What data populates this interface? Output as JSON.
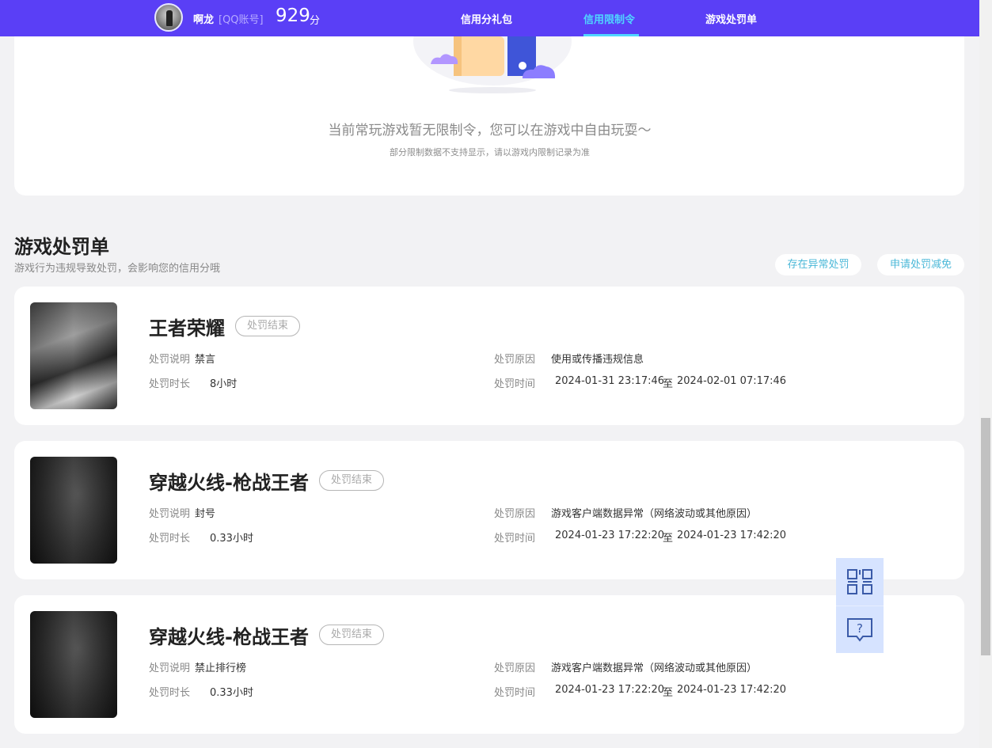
{
  "header": {
    "username": "啊龙",
    "account_type": "[QQ账号]",
    "score": "929",
    "score_unit": "分",
    "nav": [
      {
        "label": "信用分礼包",
        "active": false
      },
      {
        "label": "信用限制令",
        "active": true
      },
      {
        "label": "游戏处罚单",
        "active": false
      }
    ],
    "accent_color": "#5a3ff6",
    "active_color": "#4fd6ff"
  },
  "restriction": {
    "empty_title": "当前常玩游戏暂无限制令，您可以在游戏中自由玩耍～",
    "empty_note": "部分限制数据不支持显示，请以游戏内限制记录为准"
  },
  "penalties": {
    "title": "游戏处罚单",
    "subtitle": "游戏行为违规导致处罚，会影响您的信用分哦",
    "actions": {
      "report_abnormal": "存在异常处罚",
      "apply_reduction": "申请处罚减免"
    },
    "labels": {
      "description": "处罚说明",
      "duration": "处罚时长",
      "reason": "处罚原因",
      "time": "处罚时间",
      "to": "至"
    },
    "items": [
      {
        "game": "王者荣耀",
        "status": "处罚结束",
        "description": "禁言",
        "duration": "8小时",
        "reason": "使用或传播违规信息",
        "start": "2024-01-31 23:17:46",
        "end": "2024-02-01 07:17:46"
      },
      {
        "game": "穿越火线-枪战王者",
        "status": "处罚结束",
        "description": "封号",
        "duration": "0.33小时",
        "reason": "游戏客户端数据异常（网络波动或其他原因）",
        "start": "2024-01-23 17:22:20",
        "end": "2024-01-23 17:42:20"
      },
      {
        "game": "穿越火线-枪战王者",
        "status": "处罚结束",
        "description": "禁止排行榜",
        "duration": "0.33小时",
        "reason": "游戏客户端数据异常（网络波动或其他原因）",
        "start": "2024-01-23 17:22:20",
        "end": "2024-01-23 17:42:20"
      }
    ]
  },
  "floating_tools": [
    "qrcode-icon",
    "help-chat-icon"
  ]
}
